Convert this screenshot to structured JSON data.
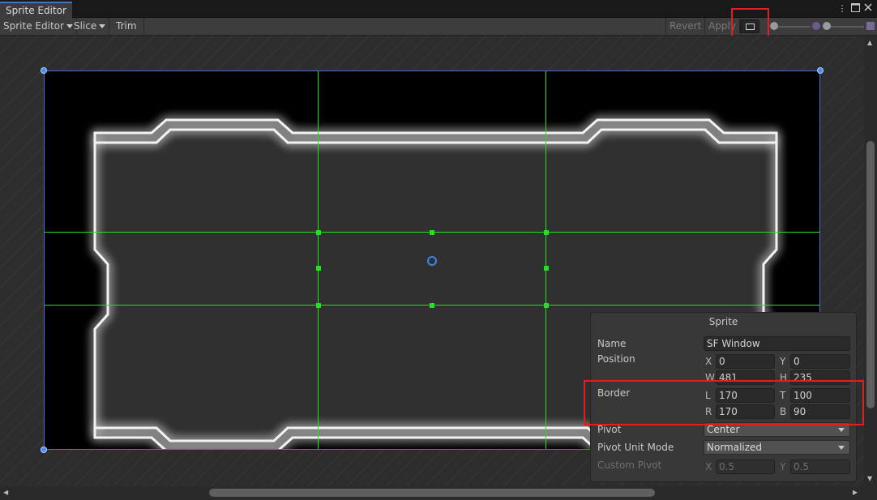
{
  "window": {
    "tab_title": "Sprite Editor",
    "menu_icon": "kebab-menu-icon",
    "maximize_icon": "maximize-icon",
    "close_icon": "close-icon"
  },
  "toolbar": {
    "sprite_editor_label": "Sprite Editor",
    "slice_label": "Slice",
    "trim_label": "Trim",
    "revert_label": "Revert",
    "apply_label": "Apply",
    "alpha_toggle_icon": "alpha-channel-icon",
    "mip_icon": "mipmap-icon"
  },
  "sprite_panel": {
    "title": "Sprite",
    "name_label": "Name",
    "name_value": "SF Window",
    "position_label": "Position",
    "x_label": "X",
    "x_value": "0",
    "y_label": "Y",
    "y_value": "0",
    "w_label": "W",
    "w_value": "481",
    "h_label": "H",
    "h_value": "235",
    "border_label": "Border",
    "l_label": "L",
    "l_value": "170",
    "t_label": "T",
    "t_value": "100",
    "r_label": "R",
    "r_value": "170",
    "b_label": "B",
    "b_value": "90",
    "pivot_label": "Pivot",
    "pivot_value": "Center",
    "pivot_unit_mode_label": "Pivot Unit Mode",
    "pivot_unit_mode_value": "Normalized",
    "custom_pivot_label": "Custom Pivot",
    "custom_x_label": "X",
    "custom_x_value": "0.5",
    "custom_y_label": "Y",
    "custom_y_value": "0.5"
  },
  "colors": {
    "highlight": "#e02020",
    "slice_guides": "#22e022",
    "pivot": "#3a86ef"
  }
}
